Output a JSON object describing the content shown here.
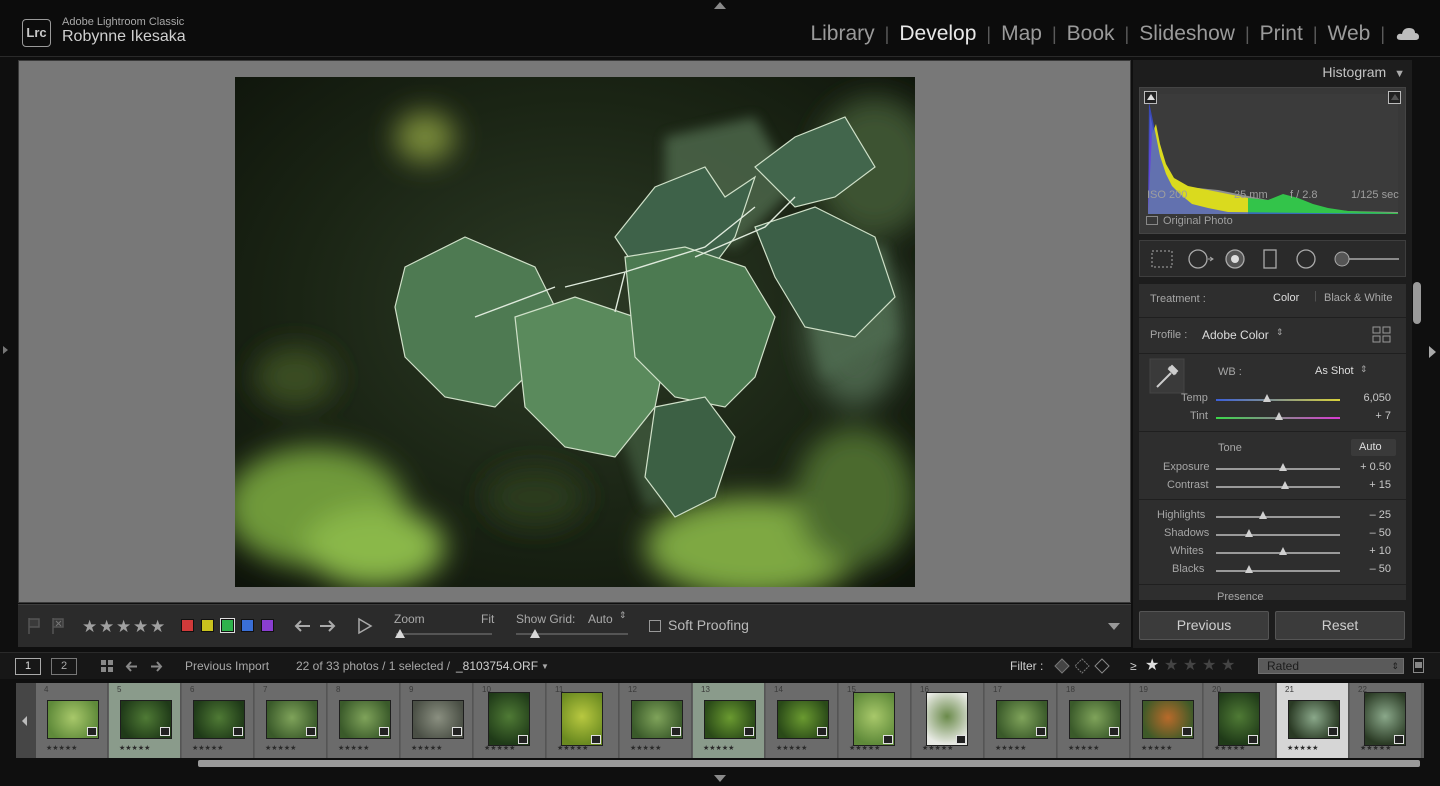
{
  "app": {
    "name": "Adobe Lightroom Classic",
    "logo_text": "Lrc",
    "user": "Robynne Ikesaka"
  },
  "modules": [
    {
      "label": "Library",
      "active": false
    },
    {
      "label": "Develop",
      "active": true
    },
    {
      "label": "Map",
      "active": false
    },
    {
      "label": "Book",
      "active": false
    },
    {
      "label": "Slideshow",
      "active": false
    },
    {
      "label": "Print",
      "active": false
    },
    {
      "label": "Web",
      "active": false
    }
  ],
  "toolbar": {
    "zoom_label": "Zoom",
    "zoom_value": "Fit",
    "show_grid_label": "Show Grid:",
    "show_grid_value": "Auto",
    "soft_proofing_label": "Soft Proofing",
    "color_labels": [
      "#d03a3a",
      "#c9c21e",
      "#2fb24b",
      "#3a6fd6",
      "#8a3ed0"
    ]
  },
  "histogram": {
    "title": "Histogram",
    "exif": {
      "iso": "ISO 200",
      "focal": "25 mm",
      "aperture": "f / 2.8",
      "shutter": "1/125 sec"
    },
    "original_photo_label": "Original Photo"
  },
  "basic": {
    "treatment_label": "Treatment :",
    "treatment_color": "Color",
    "treatment_bw": "Black & White",
    "profile_label": "Profile :",
    "profile_value": "Adobe Color",
    "wb_label": "WB :",
    "wb_value": "As Shot",
    "temp": {
      "label": "Temp",
      "value": "6,050",
      "fraction": 0.41
    },
    "tint": {
      "label": "Tint",
      "value": "+ 7",
      "fraction": 0.51
    },
    "tone_label": "Tone",
    "auto_label": "Auto",
    "exposure": {
      "label": "Exposure",
      "value": "+ 0.50",
      "fraction": 0.54
    },
    "contrast": {
      "label": "Contrast",
      "value": "+ 15",
      "fraction": 0.56
    },
    "highlights": {
      "label": "Highlights",
      "value": "– 25",
      "fraction": 0.38
    },
    "shadows": {
      "label": "Shadows",
      "value": "– 50",
      "fraction": 0.27
    },
    "whites": {
      "label": "Whites",
      "value": "+ 10",
      "fraction": 0.54
    },
    "blacks": {
      "label": "Blacks",
      "value": "– 50",
      "fraction": 0.27
    },
    "presence_label": "Presence"
  },
  "buttons": {
    "previous": "Previous",
    "reset": "Reset"
  },
  "filmstrip_bar": {
    "page1": "1",
    "page2": "2",
    "source": "Previous Import",
    "info_prefix": "22 of 33 photos / 1 selected /",
    "filename": "_8103754.ORF",
    "filter_label": "Filter :",
    "rating_op": "≥",
    "filter_value": "Rated"
  },
  "filmstrip": [
    {
      "num": "4",
      "stars": "★★★★★",
      "palette": "lgreen"
    },
    {
      "num": "5",
      "stars": "★★★★★",
      "palette": "dgreen",
      "selected": true
    },
    {
      "num": "6",
      "stars": "★★★★★",
      "palette": "dgreen"
    },
    {
      "num": "7",
      "stars": "★★★★★",
      "palette": "mgreen"
    },
    {
      "num": "8",
      "stars": "★★★★★",
      "palette": "mgreen"
    },
    {
      "num": "9",
      "stars": "★★★★★",
      "palette": "grey"
    },
    {
      "num": "10",
      "stars": "★★★★★",
      "palette": "dgreen"
    },
    {
      "num": "11",
      "stars": "★★★★★",
      "palette": "yellowgreen"
    },
    {
      "num": "12",
      "stars": "★★★★★",
      "palette": "mgreen"
    },
    {
      "num": "13",
      "stars": "★★★★★",
      "palette": "fern",
      "selected": true
    },
    {
      "num": "14",
      "stars": "★★★★★",
      "palette": "fern"
    },
    {
      "num": "15",
      "stars": "★★★★★",
      "palette": "lgreen"
    },
    {
      "num": "16",
      "stars": "★★★★★",
      "palette": "white"
    },
    {
      "num": "17",
      "stars": "★★★★★",
      "palette": "mgreen"
    },
    {
      "num": "18",
      "stars": "★★★★★",
      "palette": "mgreen"
    },
    {
      "num": "19",
      "stars": "★★★★★",
      "palette": "orange"
    },
    {
      "num": "20",
      "stars": "★★★★★",
      "palette": "dgreen"
    },
    {
      "num": "21",
      "stars": "★★★★★",
      "palette": "leaf",
      "active": true
    },
    {
      "num": "22",
      "stars": "★★★★★",
      "palette": "leaf"
    }
  ]
}
